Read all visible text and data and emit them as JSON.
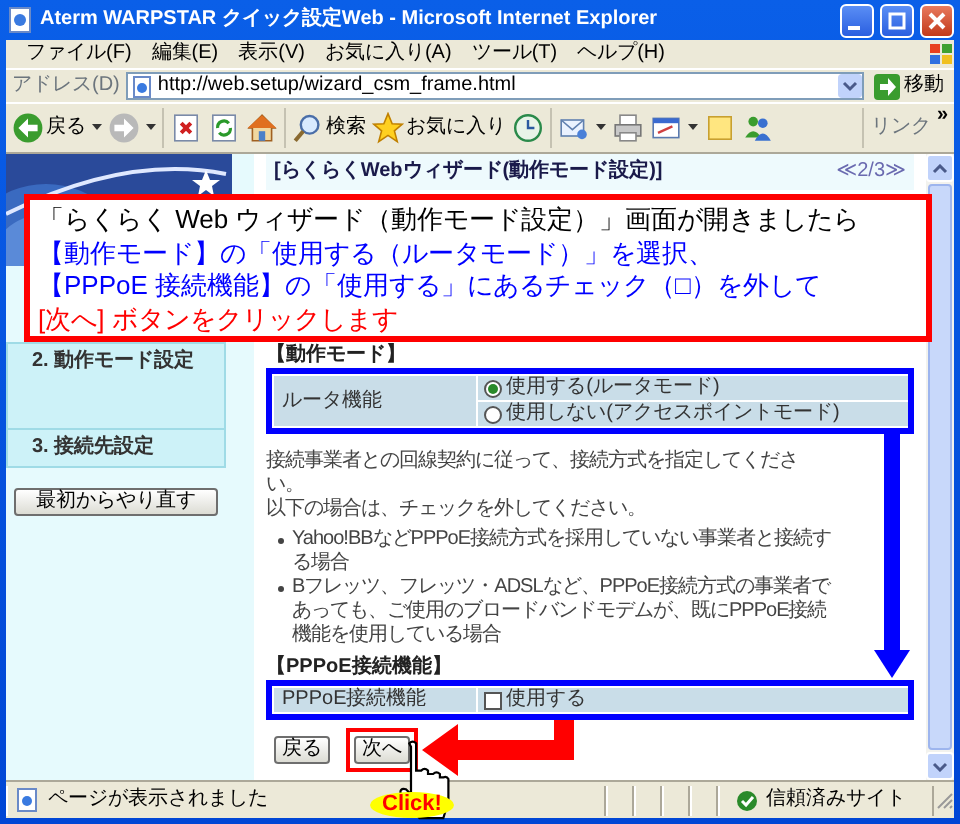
{
  "window": {
    "title": "Aterm WARPSTAR クイック設定Web - Microsoft Internet Explorer"
  },
  "menu": [
    "ファイル(F)",
    "編集(E)",
    "表示(V)",
    "お気に入り(A)",
    "ツール(T)",
    "ヘルプ(H)"
  ],
  "address": {
    "label": "アドレス(D)",
    "value": "http://web.setup/wizard_csm_frame.html",
    "go": "移動"
  },
  "toolbar": [
    {
      "kind": "back",
      "label": "戻る"
    },
    {
      "kind": "forward"
    },
    {
      "kind": "stop"
    },
    {
      "kind": "refresh"
    },
    {
      "kind": "home"
    },
    {
      "kind": "search",
      "label": "検索"
    },
    {
      "kind": "favorites",
      "label": "お気に入り"
    },
    {
      "kind": "history"
    },
    {
      "kind": "mail"
    },
    {
      "kind": "print"
    },
    {
      "kind": "edit"
    },
    {
      "kind": "note"
    },
    {
      "kind": "messenger"
    }
  ],
  "links": {
    "label": "リンク",
    "more": "»"
  },
  "sidebar": {
    "items": [
      "2. 動作モード設定",
      "3. 接続先設定"
    ],
    "restart": "最初からやり直す"
  },
  "main": {
    "title": "[らくらくWebウィザード(動作モード設定)]",
    "page": "≪2/3≫",
    "mode_heading": "【動作モード】",
    "router": {
      "label": "ルータ機能",
      "options": [
        {
          "label": "使用する(ルータモード)",
          "selected": true
        },
        {
          "label": "使用しない(アクセスポイントモード)",
          "selected": false
        }
      ]
    },
    "notes": [
      "接続事業者との回線契約に従って、接続方式を指定してください。",
      "以下の場合は、チェックを外してください。"
    ],
    "bullets": [
      "Yahoo!BBなどPPPoE接続方式を採用していない事業者と接続する場合",
      "Bフレッツ、フレッツ・ADSLなど、PPPoE接続方式の事業者であっても、ご使用のブロードバンドモデムが、既にPPPoE接続機能を使用している場合"
    ],
    "pppoe_heading": "【PPPoE接続機能】",
    "pppoe": {
      "label": "PPPoE接続機能",
      "option": "使用する",
      "checked": false
    },
    "buttons": [
      {
        "label": "戻る",
        "highlighted": false
      },
      {
        "label": "次へ",
        "highlighted": true
      }
    ]
  },
  "callout": [
    {
      "text": "「らくらく Web ウィザード（動作モード設定）」画面が開きましたら",
      "color": "#000000"
    },
    {
      "text": "【動作モード】の「使用する（ルータモード）」を選択、",
      "color": "#0000ff"
    },
    {
      "text": "【PPPoE 接続機能】の「使用する」にあるチェック（□）を外して",
      "color": "#0000ff"
    },
    {
      "text": "[次へ] ボタンをクリックします",
      "color": "#ff0000"
    }
  ],
  "click_label": "Click!",
  "status_bar": {
    "text": "ページが表示されました",
    "zone": "信頼済みサイト"
  }
}
